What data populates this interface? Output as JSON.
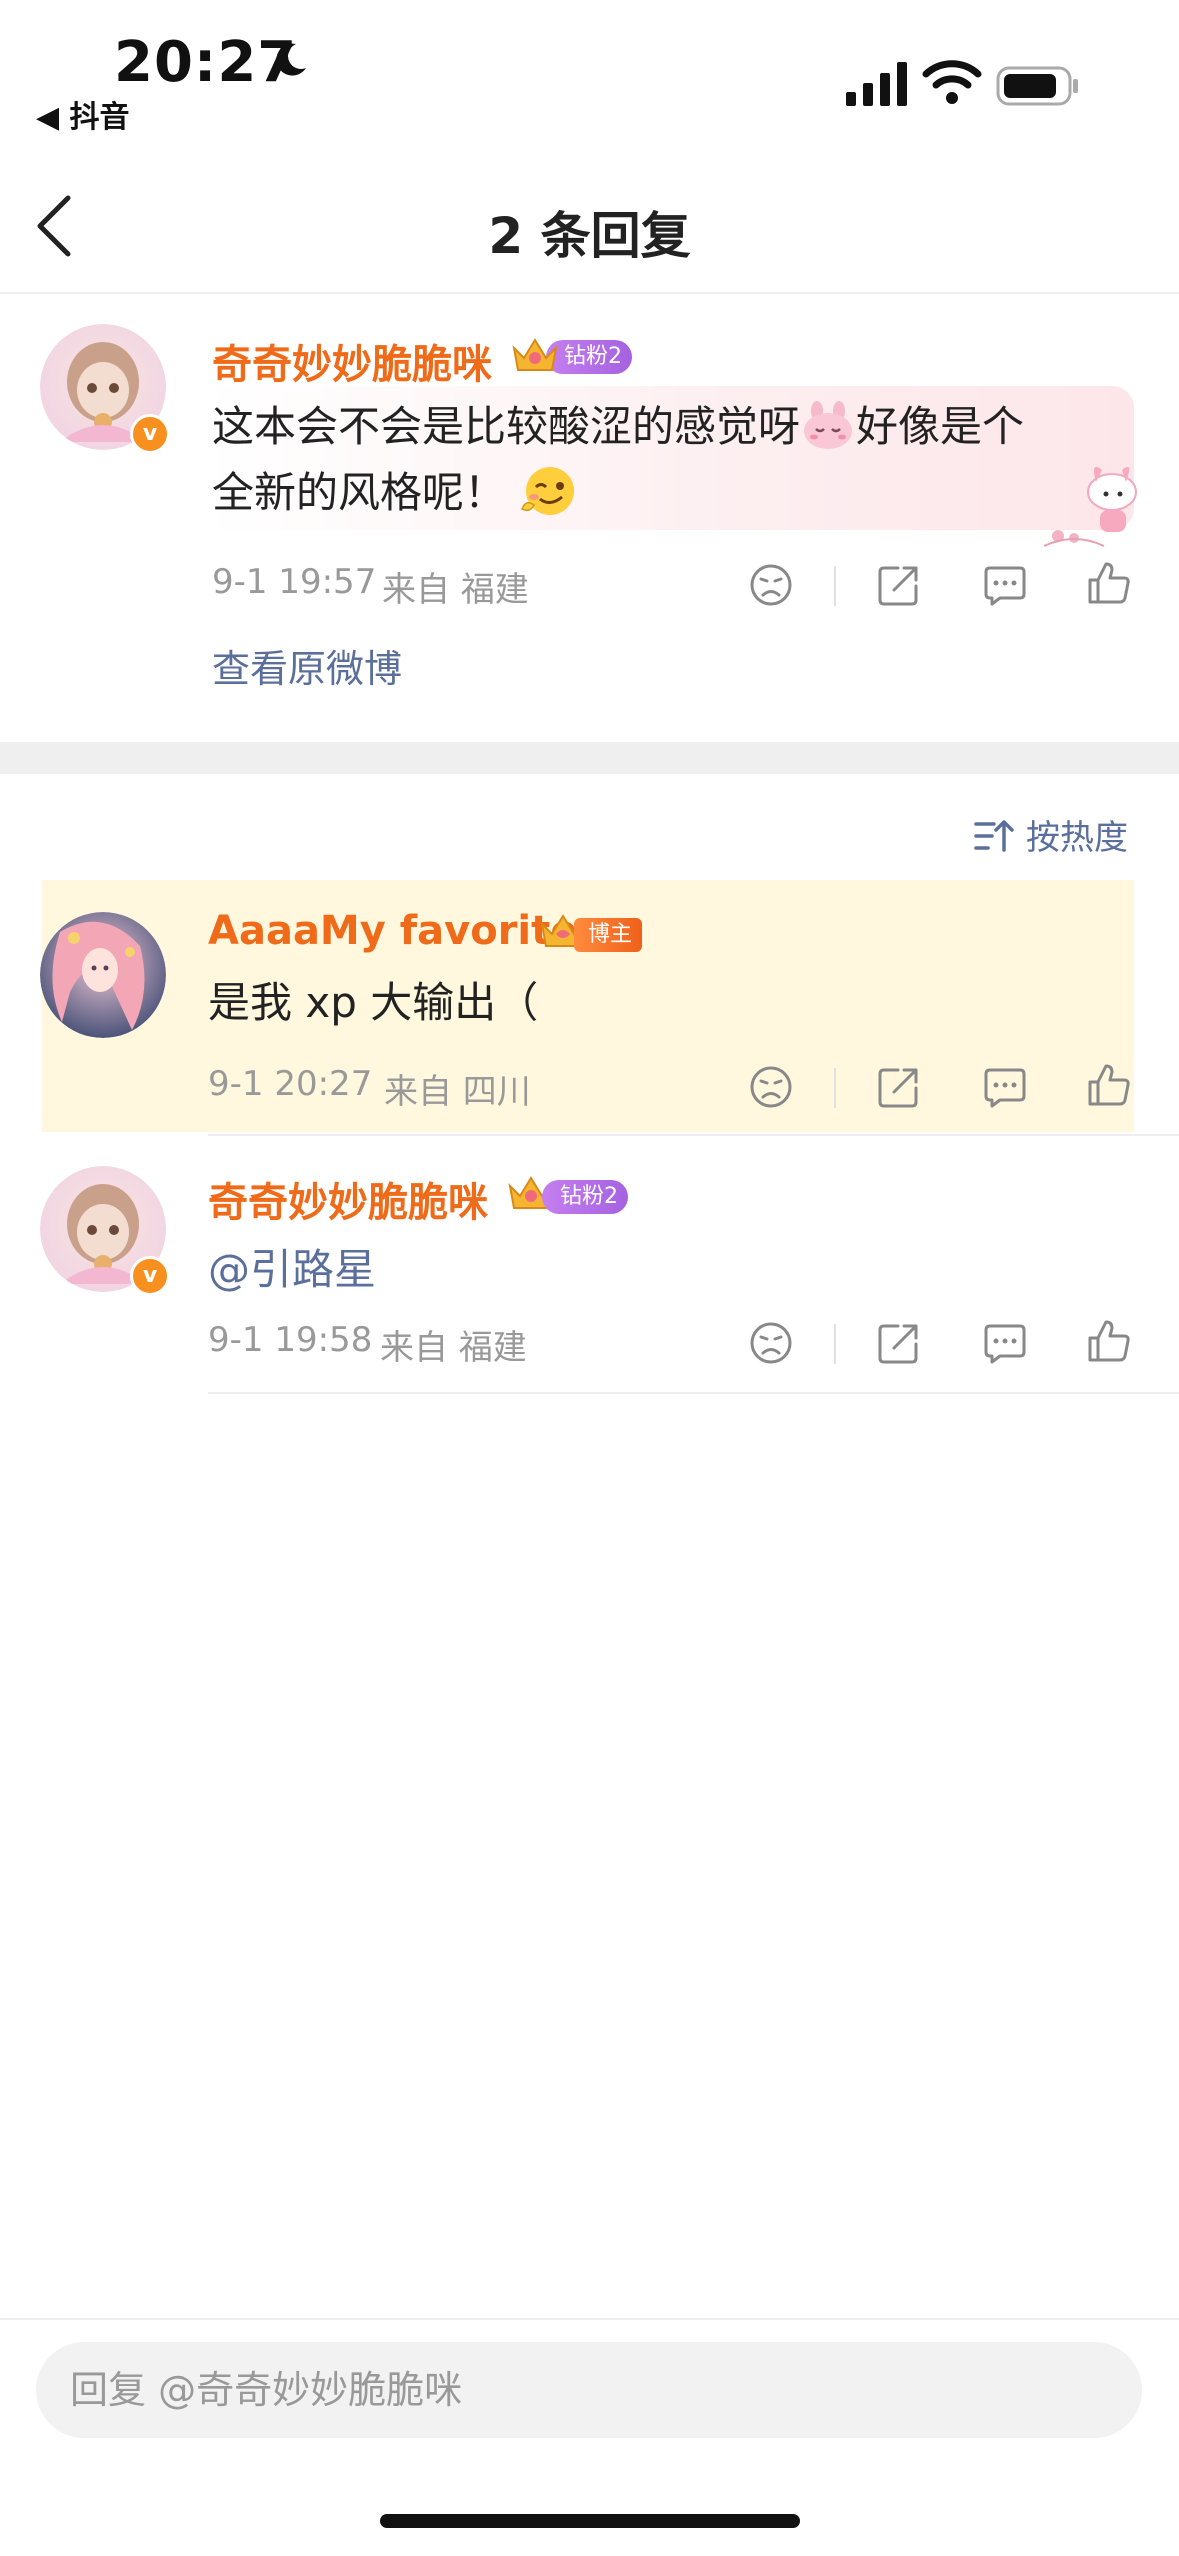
{
  "status_bar": {
    "time": "20:27",
    "back_app_label": "◀ 抖音"
  },
  "nav": {
    "title": "2 条回复"
  },
  "main_comment": {
    "username": "奇奇妙妙脆脆咪",
    "fan_badge": "钻粉2",
    "text_line1": "这本会不会是比较酸涩的感觉呀",
    "text_line1_tail": "好像是个",
    "text_line2": "全新的风格呢！",
    "date": "9-1 19:57",
    "from_label": "来自 福建",
    "view_original": "查看原微博",
    "verified_mark": "v"
  },
  "sort": {
    "label": "按热度"
  },
  "replies": [
    {
      "username": "AaaaMy favorite",
      "badge": "博主",
      "text": "是我 xp 大输出（",
      "date": "9-1 20:27",
      "from_label": "来自 四川",
      "highlighted": true
    },
    {
      "username": "奇奇妙妙脆脆咪",
      "badge": "钻粉2",
      "mention": "@引路星",
      "date": "9-1 19:58",
      "from_label": "来自 福建",
      "verified_mark": "v"
    }
  ],
  "reply_box": {
    "placeholder": "回复 @奇奇妙妙脆脆咪"
  },
  "colors": {
    "username_orange": "#ef6b1a",
    "link_blue": "#5b6f9c",
    "highlight_bg": "#fff8de",
    "meta_gray": "#999999"
  },
  "icons": [
    "dislike-icon",
    "share-icon",
    "comment-icon",
    "like-icon",
    "sort-icon",
    "back-chevron-icon"
  ]
}
